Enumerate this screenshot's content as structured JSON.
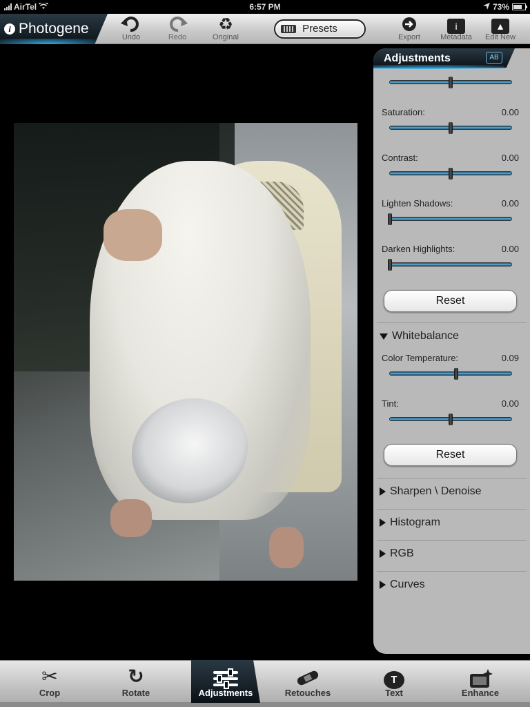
{
  "status_bar": {
    "carrier": "AirTel",
    "time": "6:57 PM",
    "battery": "73%",
    "battery_level": 0.73,
    "icons": [
      "signal-icon",
      "wifi-icon",
      "location-arrow-icon",
      "battery-icon"
    ]
  },
  "app": {
    "name": "Photogene"
  },
  "toolbar": {
    "undo_label": "Undo",
    "redo_label": "Redo",
    "original_label": "Original",
    "presets_label": "Presets",
    "export_label": "Export",
    "metadata_label": "Metadata",
    "edit_new_label": "Edit New"
  },
  "panel": {
    "title": "Adjustments",
    "sliders": [
      {
        "label": "",
        "value": "",
        "position": 0.5
      },
      {
        "label": "Saturation:",
        "value": "0.00",
        "position": 0.5
      },
      {
        "label": "Contrast:",
        "value": "0.00",
        "position": 0.5
      },
      {
        "label": "Lighten Shadows:",
        "value": "0.00",
        "position": 0.0
      },
      {
        "label": "Darken Highlights:",
        "value": "0.00",
        "position": 0.0
      }
    ],
    "reset_label": "Reset",
    "whitebalance": {
      "title": "Whitebalance",
      "sliders": [
        {
          "label": "Color Temperature:",
          "value": "0.09",
          "position": 0.545
        },
        {
          "label": "Tint:",
          "value": "0.00",
          "position": 0.5
        }
      ],
      "reset_label": "Reset"
    },
    "collapsed_sections": [
      "Sharpen \\ Denoise",
      "Histogram",
      "RGB",
      "Curves"
    ]
  },
  "tabs": [
    {
      "label": "Crop",
      "icon": "scissors-icon"
    },
    {
      "label": "Rotate",
      "icon": "rotate-icon"
    },
    {
      "label": "Adjustments",
      "icon": "sliders-icon",
      "active": true
    },
    {
      "label": "Retouches",
      "icon": "bandage-icon"
    },
    {
      "label": "Text",
      "icon": "text-bubble-icon"
    },
    {
      "label": "Enhance",
      "icon": "enhance-icon"
    }
  ],
  "colors": {
    "accent": "#35a8e0",
    "header_dark": "#0b1217",
    "panel_bg": "#b9b9b9"
  }
}
